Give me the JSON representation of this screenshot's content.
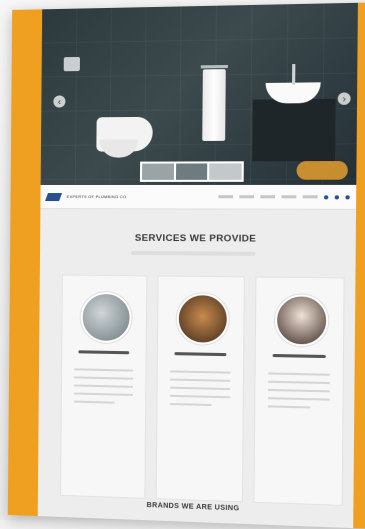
{
  "colors": {
    "frame": "#f0a021",
    "screen_bg": "#ededed",
    "hero_dark": "#2c3a3e",
    "brand_blue": "#2a4f8f"
  },
  "navbar": {
    "brand": "EXPERTS OF PLUMBING CO.",
    "links": [],
    "icons": [
      "facebook-icon",
      "twitter-icon",
      "instagram-icon"
    ]
  },
  "hero": {
    "arrows": {
      "left": "‹",
      "right": "›"
    }
  },
  "services": {
    "title": "SERVICES WE PROVIDE",
    "cards": [
      {
        "image": "plumbing-photo"
      },
      {
        "image": "technician-photo"
      },
      {
        "image": "support-photo"
      }
    ]
  },
  "brands": {
    "title": "BRANDS WE ARE USING"
  }
}
